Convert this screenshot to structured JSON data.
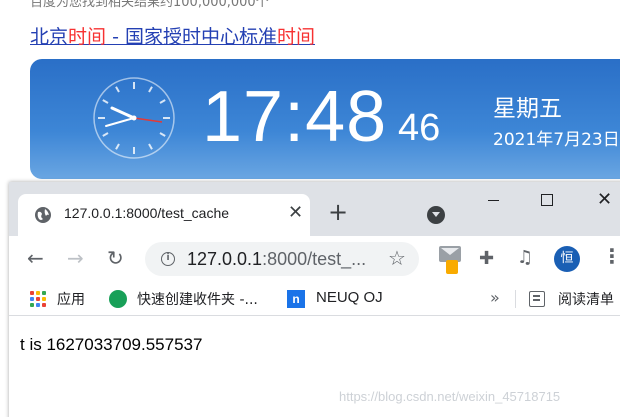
{
  "background_page": {
    "cut_text": "百度为您找到相关结果约100,000,000个",
    "result_link": {
      "part1": "北京",
      "part2": "时间",
      "part3": " - 国家授时中心标准",
      "part4": "时间"
    },
    "clock_widget": {
      "time_hm": "17:48",
      "seconds": "46",
      "weekday": "星期五",
      "date": "2021年7月23日"
    }
  },
  "browser": {
    "tab": {
      "title": "127.0.0.1:8000/test_cache",
      "icon": "globe-icon"
    },
    "window_controls": {
      "minimize": "minimize-icon",
      "maximize": "maximize-icon",
      "close": "close-icon"
    },
    "omnibox": {
      "host": "127.0.0.1",
      "rest": ":8000/test_..."
    },
    "profile_initial": "恒",
    "bookmarks": [
      {
        "label": "应用"
      },
      {
        "label": "快速创建收件夹 -..."
      },
      {
        "label": "NEUQ OJ"
      }
    ],
    "more_bookmarks": "»",
    "reading_list": "阅读清单"
  },
  "page": {
    "body_text": "t is 1627033709.557537",
    "watermark": "https://blog.csdn.net/weixin_45718715"
  },
  "colors": {
    "accent": "#1a73e8",
    "card_blue": "#2a6fc7",
    "link_blue": "#2440b3",
    "highlight_red": "#f73131"
  }
}
